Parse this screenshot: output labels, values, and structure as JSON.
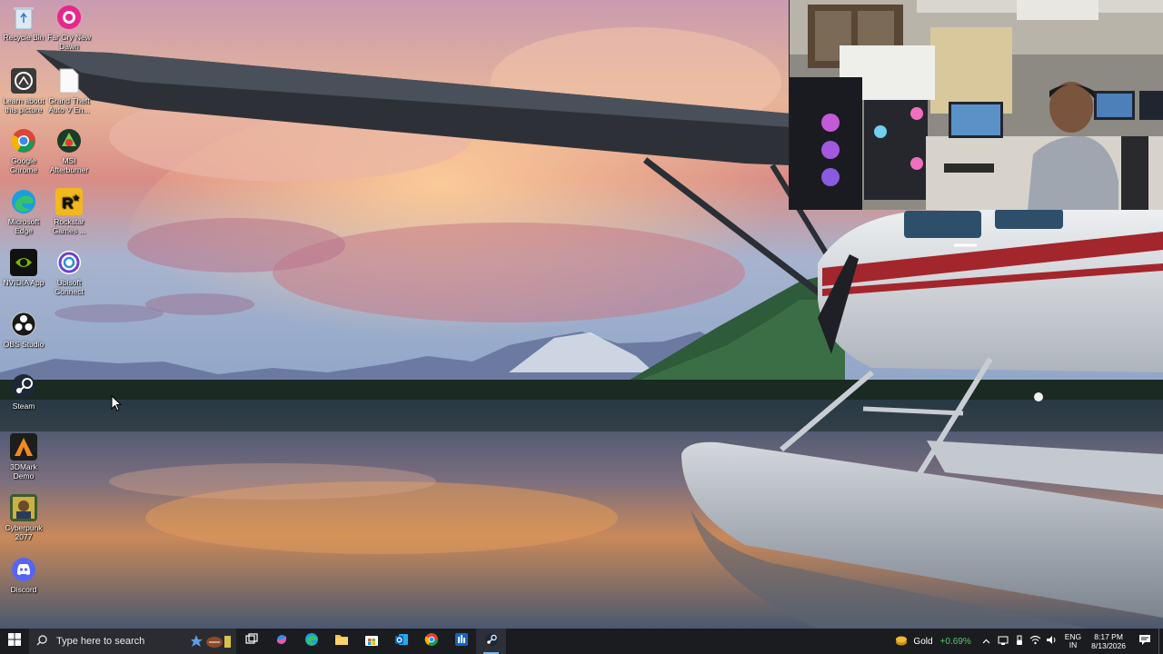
{
  "desktop": {
    "icons": [
      {
        "label": "Recycle Bin",
        "icon": "recycle-bin-icon"
      },
      {
        "label": "Far Cry New Dawn",
        "icon": "far-cry-icon"
      },
      {
        "label": "Learn about this picture",
        "icon": "learn-picture-icon"
      },
      {
        "label": "Grand Theft Auto V En...",
        "icon": "file-icon"
      },
      {
        "label": "Google Chrome",
        "icon": "chrome-icon"
      },
      {
        "label": "MSI Afterburner",
        "icon": "afterburner-icon"
      },
      {
        "label": "Microsoft Edge",
        "icon": "edge-icon"
      },
      {
        "label": "Rockstar Games ...",
        "icon": "rockstar-icon"
      },
      {
        "label": "NVIDIA App",
        "icon": "nvidia-icon"
      },
      {
        "label": "Ubisoft Connect",
        "icon": "ubisoft-icon"
      },
      {
        "label": "OBS Studio",
        "icon": "obs-icon"
      },
      {
        "label": "Steam",
        "icon": "steam-icon"
      },
      {
        "label": "3DMark Demo",
        "icon": "3dmark-icon"
      },
      {
        "label": "Cyberpunk 2077",
        "icon": "cyberpunk-icon"
      },
      {
        "label": "Discord",
        "icon": "discord-icon"
      }
    ]
  },
  "taskbar": {
    "search_placeholder": "Type here to search",
    "apps": [
      {
        "name": "task-view",
        "icon": "task-view-icon"
      },
      {
        "name": "copilot",
        "icon": "copilot-icon"
      },
      {
        "name": "edge",
        "icon": "edge-icon"
      },
      {
        "name": "file-explorer",
        "icon": "folder-icon"
      },
      {
        "name": "microsoft-store",
        "icon": "store-icon"
      },
      {
        "name": "outlook",
        "icon": "outlook-icon"
      },
      {
        "name": "chrome",
        "icon": "chrome-icon"
      },
      {
        "name": "msi-app",
        "icon": "msi-icon"
      },
      {
        "name": "steam",
        "icon": "steam-icon"
      }
    ],
    "stock": {
      "name": "Gold",
      "change": "+0.69%",
      "change_color": "#58c96a"
    },
    "language": {
      "line1": "ENG",
      "line2": "IN"
    },
    "clock": {
      "time": "8:17 PM",
      "date": "8/13/2026"
    }
  },
  "colors": {
    "taskbar_bg": "#1b1c20",
    "search_bg": "#2b2c31",
    "accent": "#76b9ed"
  }
}
